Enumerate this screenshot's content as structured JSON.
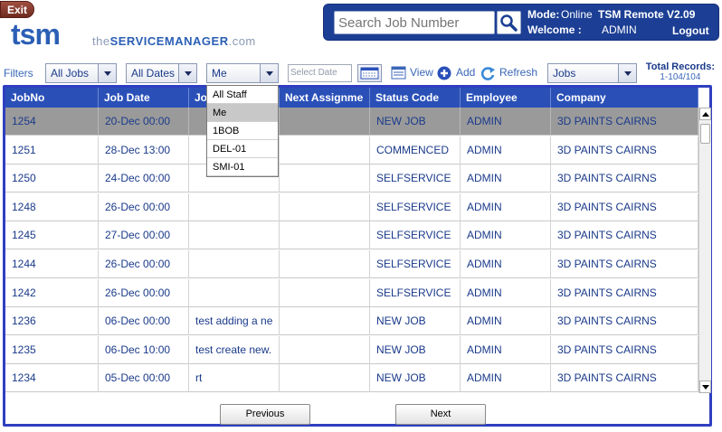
{
  "header": {
    "exit_label": "Exit",
    "logo_tsm": "tsm",
    "logo_pre": "the",
    "logo_bold": "SERVICEMANAGER",
    "logo_post": ".com",
    "search_placeholder": "Search Job Number",
    "mode_label": "Mode:",
    "mode_value": "Online",
    "product": "TSM Remote V2.09",
    "welcome_label": "Welcome :",
    "welcome_user": "ADMIN",
    "logout_label": "Logout"
  },
  "toolbar": {
    "filters_label": "Filters",
    "jobs_filter": "All Jobs",
    "dates_filter": "All Dates",
    "staff_filter": "Me",
    "date_placeholder": "Select Date",
    "view_label": "View",
    "add_label": "Add",
    "refresh_label": "Refresh",
    "type_select": "Jobs",
    "total_records_label": "Total Records:",
    "total_records_value": "1-104/104"
  },
  "staff_dropdown": {
    "options": [
      "All Staff",
      "Me",
      "1BOB",
      "DEL-01",
      "SMI-01"
    ],
    "highlighted": "Me"
  },
  "grid": {
    "columns": [
      "JobNo",
      "Job Date",
      "Jo",
      "Next Assignme",
      "Status Code",
      "Employee",
      "Company"
    ],
    "rows": [
      [
        "1254",
        "20-Dec  00:00",
        "",
        "",
        "NEW JOB",
        "ADMIN",
        "3D PAINTS CAIRNS"
      ],
      [
        "1251",
        "28-Dec  13:00",
        "",
        "",
        "COMMENCED",
        "ADMIN",
        "3D PAINTS CAIRNS"
      ],
      [
        "1250",
        "24-Dec  00:00",
        "",
        "",
        "SELFSERVICE",
        "ADMIN",
        "3D PAINTS CAIRNS"
      ],
      [
        "1248",
        "26-Dec  00:00",
        "",
        "",
        "SELFSERVICE",
        "ADMIN",
        "3D PAINTS CAIRNS"
      ],
      [
        "1245",
        "27-Dec  00:00",
        "",
        "",
        "SELFSERVICE",
        "ADMIN",
        "3D PAINTS CAIRNS"
      ],
      [
        "1244",
        "26-Dec  00:00",
        "",
        "",
        "SELFSERVICE",
        "ADMIN",
        "3D PAINTS CAIRNS"
      ],
      [
        "1242",
        "26-Dec  00:00",
        "",
        "",
        "SELFSERVICE",
        "ADMIN",
        "3D PAINTS CAIRNS"
      ],
      [
        "1236",
        "06-Dec  00:00",
        "test adding a ne",
        "",
        "NEW JOB",
        "ADMIN",
        "3D PAINTS CAIRNS"
      ],
      [
        "1235",
        "06-Dec  10:00",
        "test create new.",
        "",
        "NEW JOB",
        "ADMIN",
        "3D PAINTS CAIRNS"
      ],
      [
        "1234",
        "05-Dec  00:00",
        "rt",
        "",
        "NEW JOB",
        "ADMIN",
        "3D PAINTS CAIRNS"
      ]
    ],
    "selected_row": 0
  },
  "pager": {
    "previous_label": "Previous",
    "next_label": "Next"
  },
  "colors": {
    "accent": "#2a50b8",
    "header_panel": "#1c3f95",
    "grid_border": "#2f3fc0",
    "selected_row": "#9a9a9a"
  }
}
